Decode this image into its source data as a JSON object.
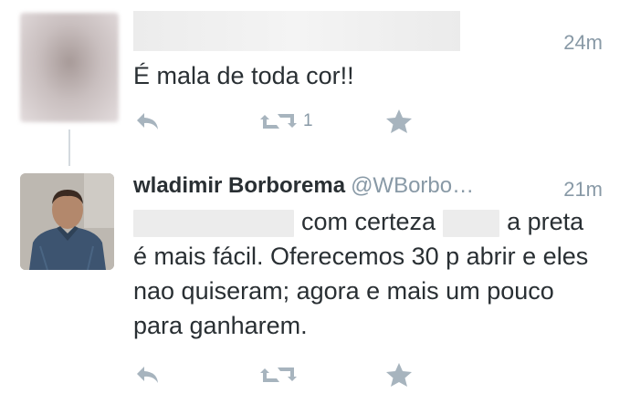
{
  "tweets": [
    {
      "time": "24m",
      "text": "É mala de toda cor!!",
      "retweet_count": "1",
      "icons": [
        "reply-icon",
        "retweet-icon",
        "favorite-icon"
      ]
    },
    {
      "display_name": "wladimir Borborema",
      "handle": "@WBorbo…",
      "time": "21m",
      "text_seg1": "com certeza",
      "text_seg2": "a",
      "text_rest": "preta é mais fácil. Oferecemos 30 p abrir e eles nao quiseram; agora e mais um pouco para ganharem.",
      "icons": [
        "reply-icon",
        "retweet-icon",
        "favorite-icon"
      ]
    }
  ],
  "colors": {
    "text": "#292f33",
    "muted": "#8899a6",
    "icon": "#a7b4be",
    "redaction": "#ececec"
  }
}
